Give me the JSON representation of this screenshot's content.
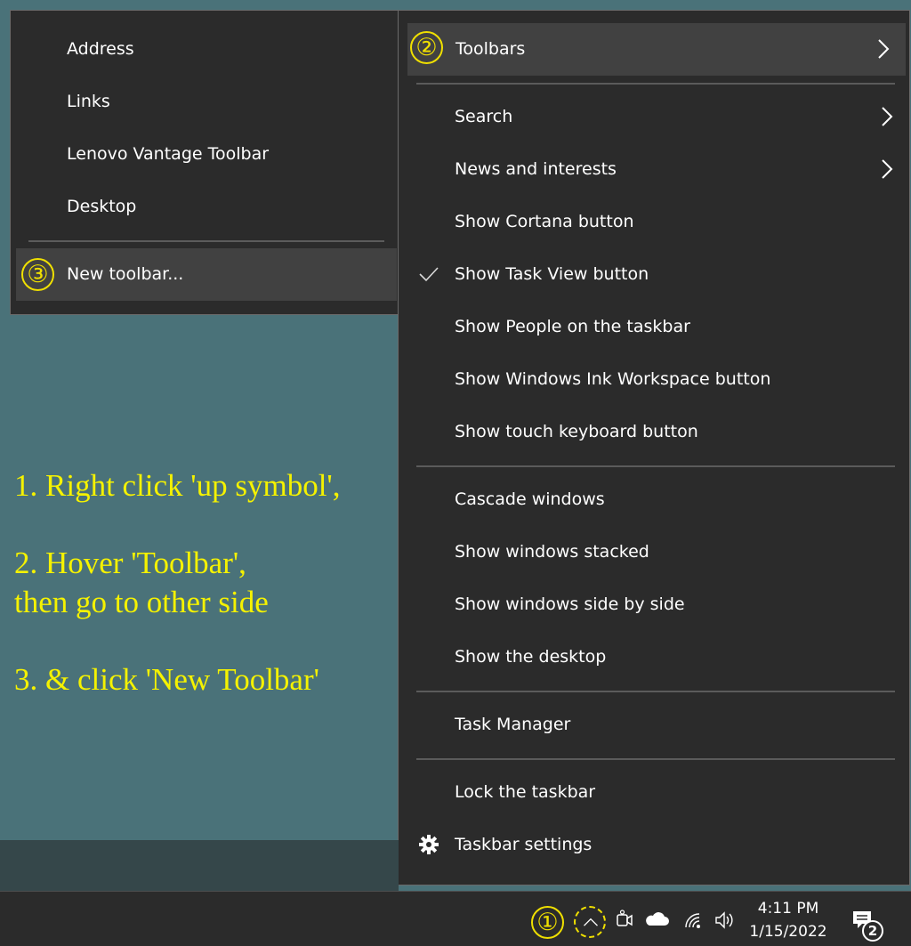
{
  "left_menu": {
    "items": [
      {
        "label": "Address"
      },
      {
        "label": "Links"
      },
      {
        "label": "Lenovo Vantage Toolbar"
      },
      {
        "label": "Desktop"
      }
    ],
    "new_toolbar": {
      "label": "New toolbar..."
    }
  },
  "right_menu": {
    "toolbars": {
      "label": "Toolbars"
    },
    "items": [
      {
        "label": "Search"
      },
      {
        "label": "News and interests"
      },
      {
        "label": "Show Cortana button"
      },
      {
        "label": "Show Task View button",
        "checked": true
      },
      {
        "label": "Show People on the taskbar"
      },
      {
        "label": "Show Windows Ink Workspace button"
      },
      {
        "label": "Show touch keyboard button"
      },
      {
        "label": "Cascade windows"
      },
      {
        "label": "Show windows stacked"
      },
      {
        "label": "Show windows side by side"
      },
      {
        "label": "Show the desktop"
      },
      {
        "label": "Task Manager"
      },
      {
        "label": "Lock the taskbar"
      },
      {
        "label": "Taskbar settings",
        "icon": "gear-icon"
      }
    ]
  },
  "annotations": {
    "markers": [
      "①",
      "②",
      "③"
    ],
    "step1": "1. Right click 'up symbol',",
    "step2_line1": "2. Hover 'Toolbar',",
    "step2_line2": "then go to other side",
    "step3": "3. & click 'New Toolbar'"
  },
  "taskbar": {
    "time": "4:11 PM",
    "date": "1/15/2022",
    "notification_count": "2",
    "tray_icons": [
      "chevron-up-icon",
      "meet-now-icon",
      "onedrive-cloud-icon",
      "wifi-icon",
      "speaker-icon",
      "action-center-icon"
    ]
  },
  "colors": {
    "desktop": "#4a7279",
    "menu_bg": "#2b2b2b",
    "highlight": "#414141",
    "annotation": "#f5f200"
  }
}
